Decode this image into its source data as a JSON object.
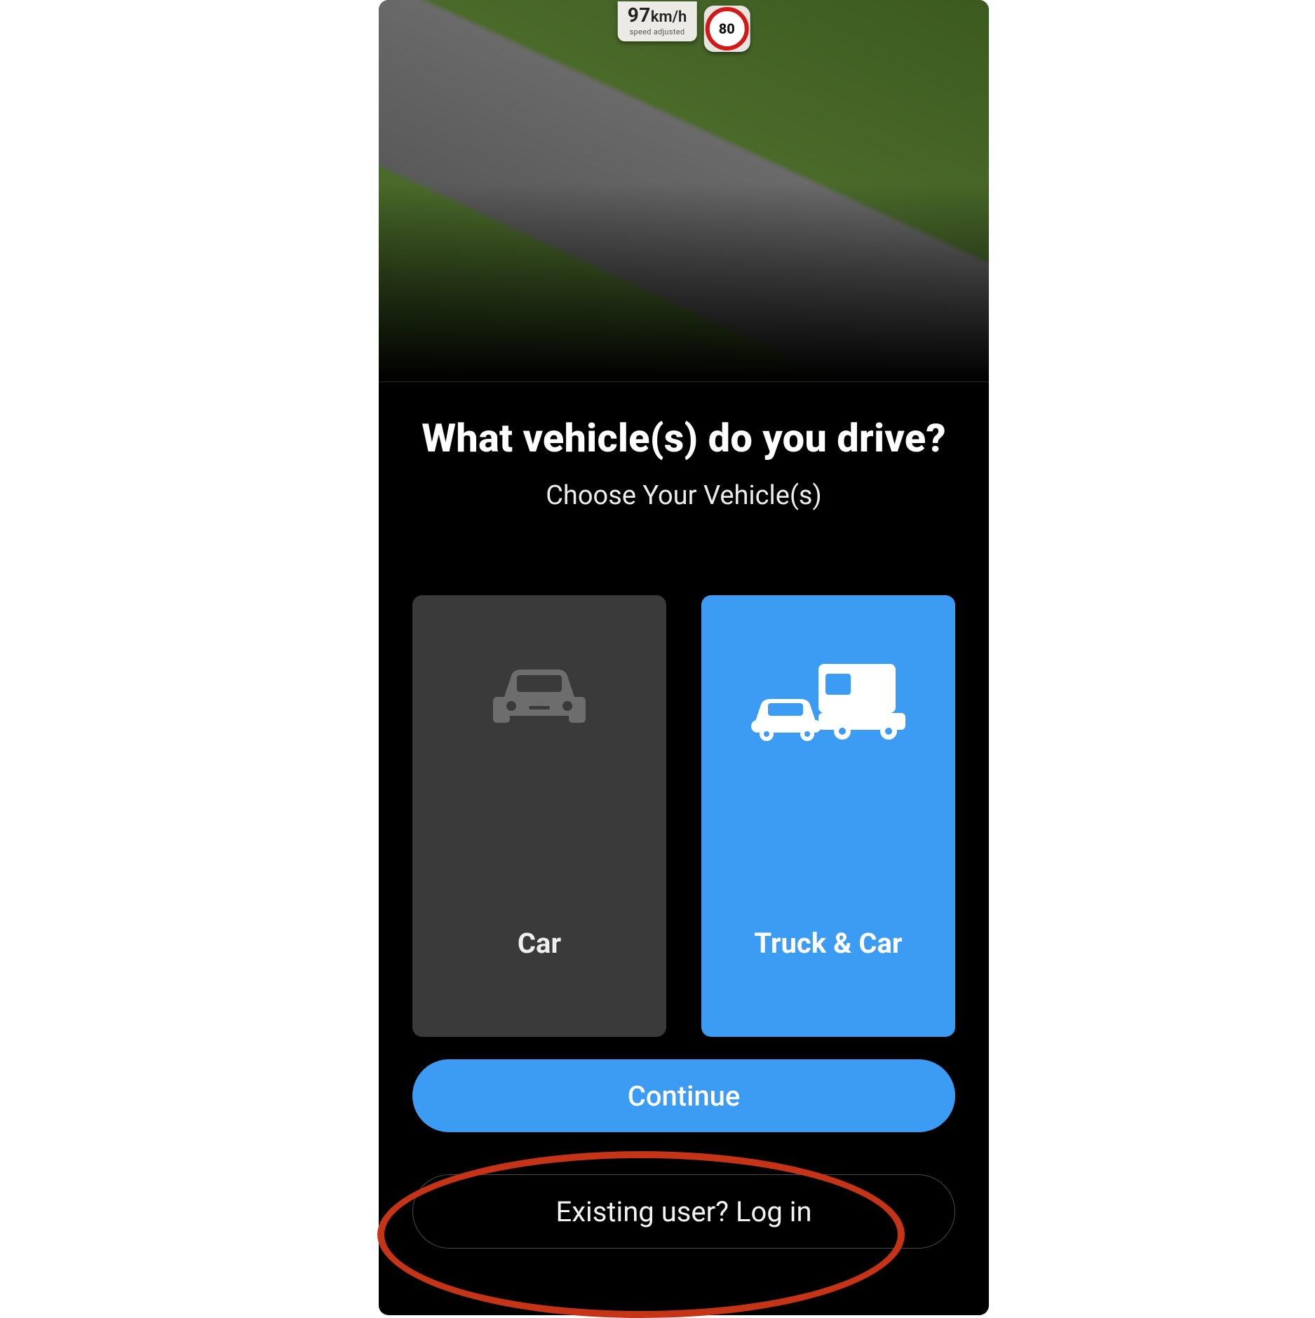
{
  "hud": {
    "speed_value": "97",
    "speed_unit": "km/h",
    "speed_caption": "speed adjusted",
    "speed_limit": "80"
  },
  "question": {
    "title": "What vehicle(s) do you drive?",
    "subtitle": "Choose Your Vehicle(s)"
  },
  "options": {
    "car_label": "Car",
    "truck_label": "Truck & Car"
  },
  "actions": {
    "continue_label": "Continue",
    "login_label": "Existing user? Log in"
  },
  "colors": {
    "accent": "#3C9BF2",
    "annotation": "#C63418"
  }
}
